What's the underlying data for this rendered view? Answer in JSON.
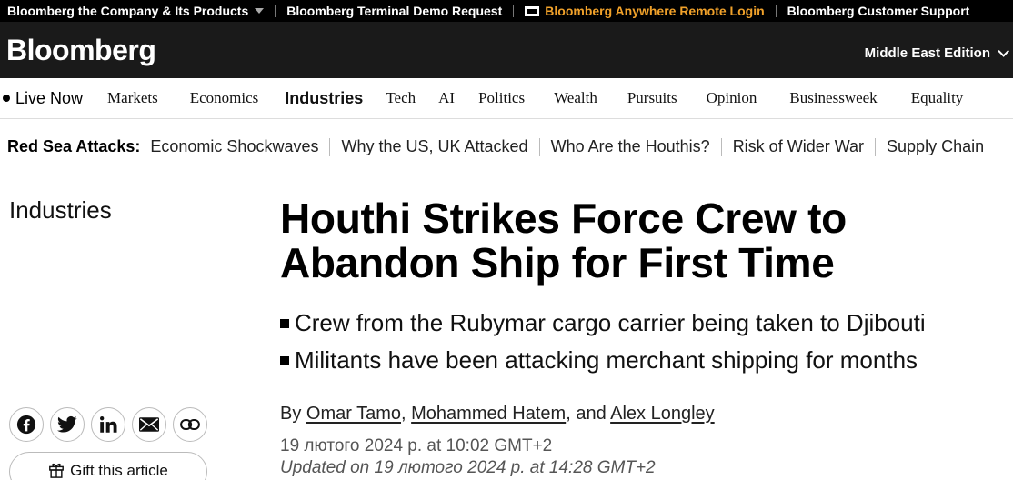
{
  "topbar": {
    "company_label": "Bloomberg the Company & Its Products",
    "terminal_label": "Bloomberg Terminal Demo Request",
    "anywhere_label": "Bloomberg Anywhere Remote Login",
    "support_label": "Bloomberg Customer Support",
    "anywhere_color": "#f0a12a"
  },
  "masthead": {
    "logo": "Bloomberg",
    "edition_label": "Middle East Edition"
  },
  "nav": {
    "live_label": "Live Now",
    "items": [
      {
        "label": "Markets"
      },
      {
        "label": "Economics"
      },
      {
        "label": "Industries",
        "active": true
      },
      {
        "label": "Tech"
      },
      {
        "label": "AI"
      },
      {
        "label": "Politics"
      },
      {
        "label": "Wealth"
      },
      {
        "label": "Pursuits"
      },
      {
        "label": "Opinion"
      },
      {
        "label": "Businessweek"
      },
      {
        "label": "Equality"
      }
    ]
  },
  "topics": {
    "lead": "Red Sea Attacks:",
    "items": [
      {
        "label": "Economic Shockwaves"
      },
      {
        "label": "Why the US, UK Attacked"
      },
      {
        "label": "Who Are the Houthis?"
      },
      {
        "label": "Risk of Wider War"
      },
      {
        "label": "Supply Chain"
      }
    ]
  },
  "article": {
    "section": "Industries",
    "headline": "Houthi Strikes Force Crew to Abandon Ship for First Time",
    "bullets": [
      {
        "text": "Crew from the Rubymar cargo carrier being taken to Djibouti"
      },
      {
        "text": "Militants have been attacking merchant shipping for months"
      }
    ],
    "byline_prefix": "By",
    "authors": [
      {
        "name": "Omar Tamo"
      },
      {
        "name": "Mohammed Hatem"
      },
      {
        "name": "Alex Longley"
      }
    ],
    "byline_sep1": ",",
    "byline_sep2": ", and",
    "published": "19 лютого 2024 р. at 10:02 GMT+2",
    "updated": "Updated on 19 лютого 2024 р. at 14:28 GMT+2"
  },
  "share": {
    "icons": [
      "facebook-icon",
      "twitter-icon",
      "linkedin-icon",
      "email-icon",
      "link-icon"
    ],
    "gift_label": "Gift this article"
  }
}
